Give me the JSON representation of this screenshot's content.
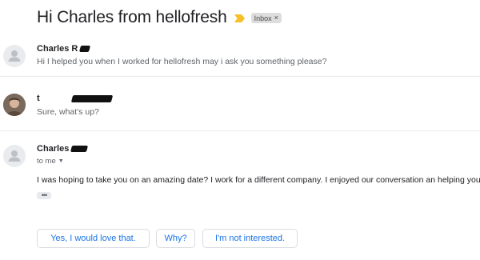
{
  "thread": {
    "subject": "Hi Charles from hellofresh",
    "label_chip": "Inbox",
    "label_chip_close": "×",
    "importance_color": "#f6c026"
  },
  "messages": [
    {
      "sender": "Charles R",
      "snippet": "Hi I helped you when I worked for hellofresh may i ask you something please?"
    },
    {
      "sender": "t",
      "snippet": "Sure, what's up?"
    },
    {
      "sender": "Charles",
      "recipient": "to me",
      "body": "I was hoping to take you on an amazing date? I work for a different company.  I enjoyed our conversation an helping you.",
      "trimmed_indicator": "•••"
    }
  ],
  "smart_replies": [
    "Yes, I would love that.",
    "Why?",
    "I'm not interested."
  ],
  "colors": {
    "accent": "#1a73e8",
    "avatar_bg": "#e9ebee",
    "avatar_glyph": "#bdc1c6"
  }
}
